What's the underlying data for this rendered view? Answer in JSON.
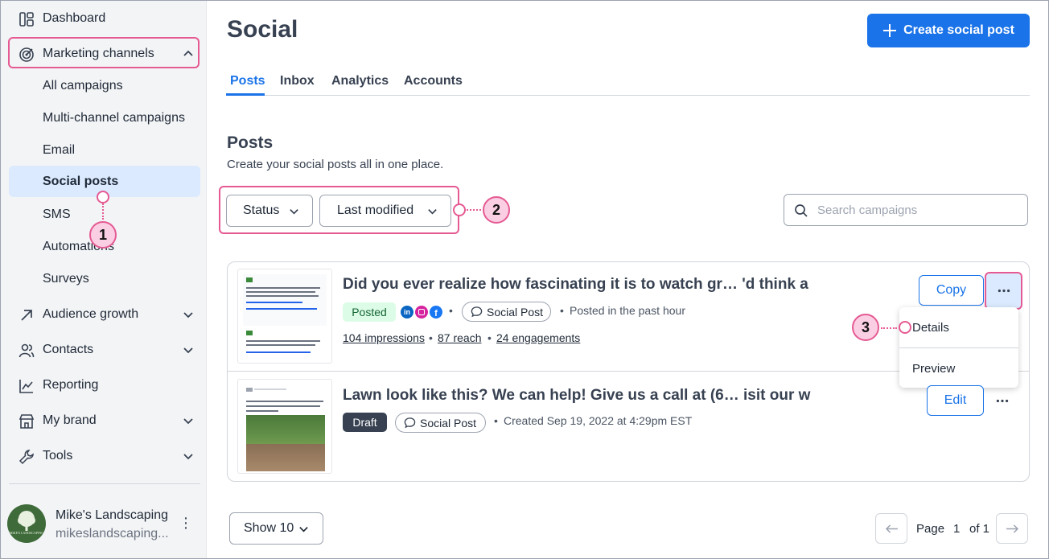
{
  "sidebar": {
    "items": [
      {
        "label": "Dashboard",
        "icon": "dashboard-icon"
      },
      {
        "label": "Marketing channels",
        "icon": "target-icon"
      },
      {
        "label": "Audience growth",
        "icon": "arrow-up-right-icon"
      },
      {
        "label": "Contacts",
        "icon": "contacts-icon"
      },
      {
        "label": "Reporting",
        "icon": "chart-icon"
      },
      {
        "label": "My brand",
        "icon": "store-icon"
      },
      {
        "label": "Tools",
        "icon": "wrench-icon"
      }
    ],
    "subitems": [
      "All campaigns",
      "Multi-channel campaigns",
      "Email",
      "Social posts",
      "SMS",
      "Automations",
      "Surveys"
    ],
    "account": {
      "name": "Mike's Landscaping",
      "email": "mikeslandscaping...",
      "logo_text": "MIKE'S LANDSCAPING"
    }
  },
  "header": {
    "title": "Social",
    "create_button": "Create social post"
  },
  "tabs": [
    "Posts",
    "Inbox",
    "Analytics",
    "Accounts"
  ],
  "section": {
    "title": "Posts",
    "subtitle": "Create your social posts all in one place."
  },
  "filters": {
    "status": "Status",
    "sort": "Last modified"
  },
  "search": {
    "placeholder": "Search campaigns"
  },
  "posts": [
    {
      "title": "Did you ever realize how fascinating it is to watch gr… 'd think a",
      "status": "Posted",
      "type": "Social Post",
      "time": "Posted in the past hour",
      "impressions": "104 impressions",
      "reach": "87 reach",
      "engagements": "24 engagements",
      "action": "Copy"
    },
    {
      "title": "Lawn look like this? We can help! Give us a call at (6… isit our w",
      "status": "Draft",
      "type": "Social Post",
      "time": "Created Sep 19, 2022 at 4:29pm EST",
      "action": "Edit"
    }
  ],
  "menu": {
    "items": [
      "Details",
      "Preview"
    ]
  },
  "pagination": {
    "show": "Show 10",
    "page_label": "Page",
    "page": "1",
    "of": "of 1"
  },
  "callouts": [
    "1",
    "2",
    "3"
  ],
  "colors": {
    "accent": "#1a73e8",
    "highlight": "#e55a93",
    "posted_bg": "#dcfce7",
    "draft_bg": "#374151"
  }
}
